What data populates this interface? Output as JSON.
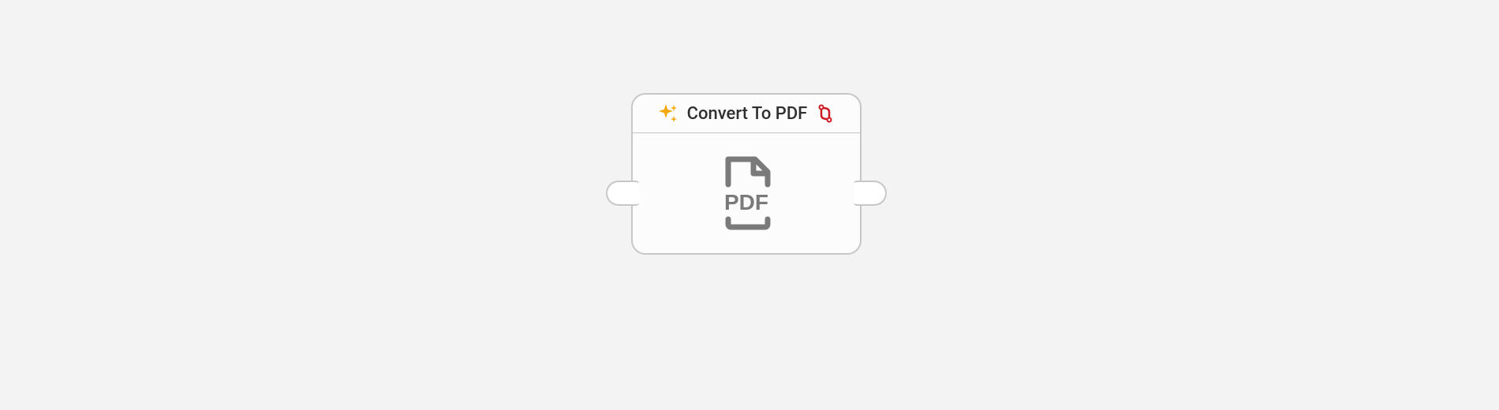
{
  "node": {
    "title": "Convert To PDF",
    "header_icon": "sparkle-icon",
    "action_icon": "convert-icon",
    "body_icon": "pdf-file-icon",
    "body_icon_label": "PDF"
  },
  "colors": {
    "accent_sparkle": "#f3a80f",
    "accent_convert": "#cc1a20",
    "icon_gray": "#7a7a7a",
    "border": "#c7c7c7"
  }
}
